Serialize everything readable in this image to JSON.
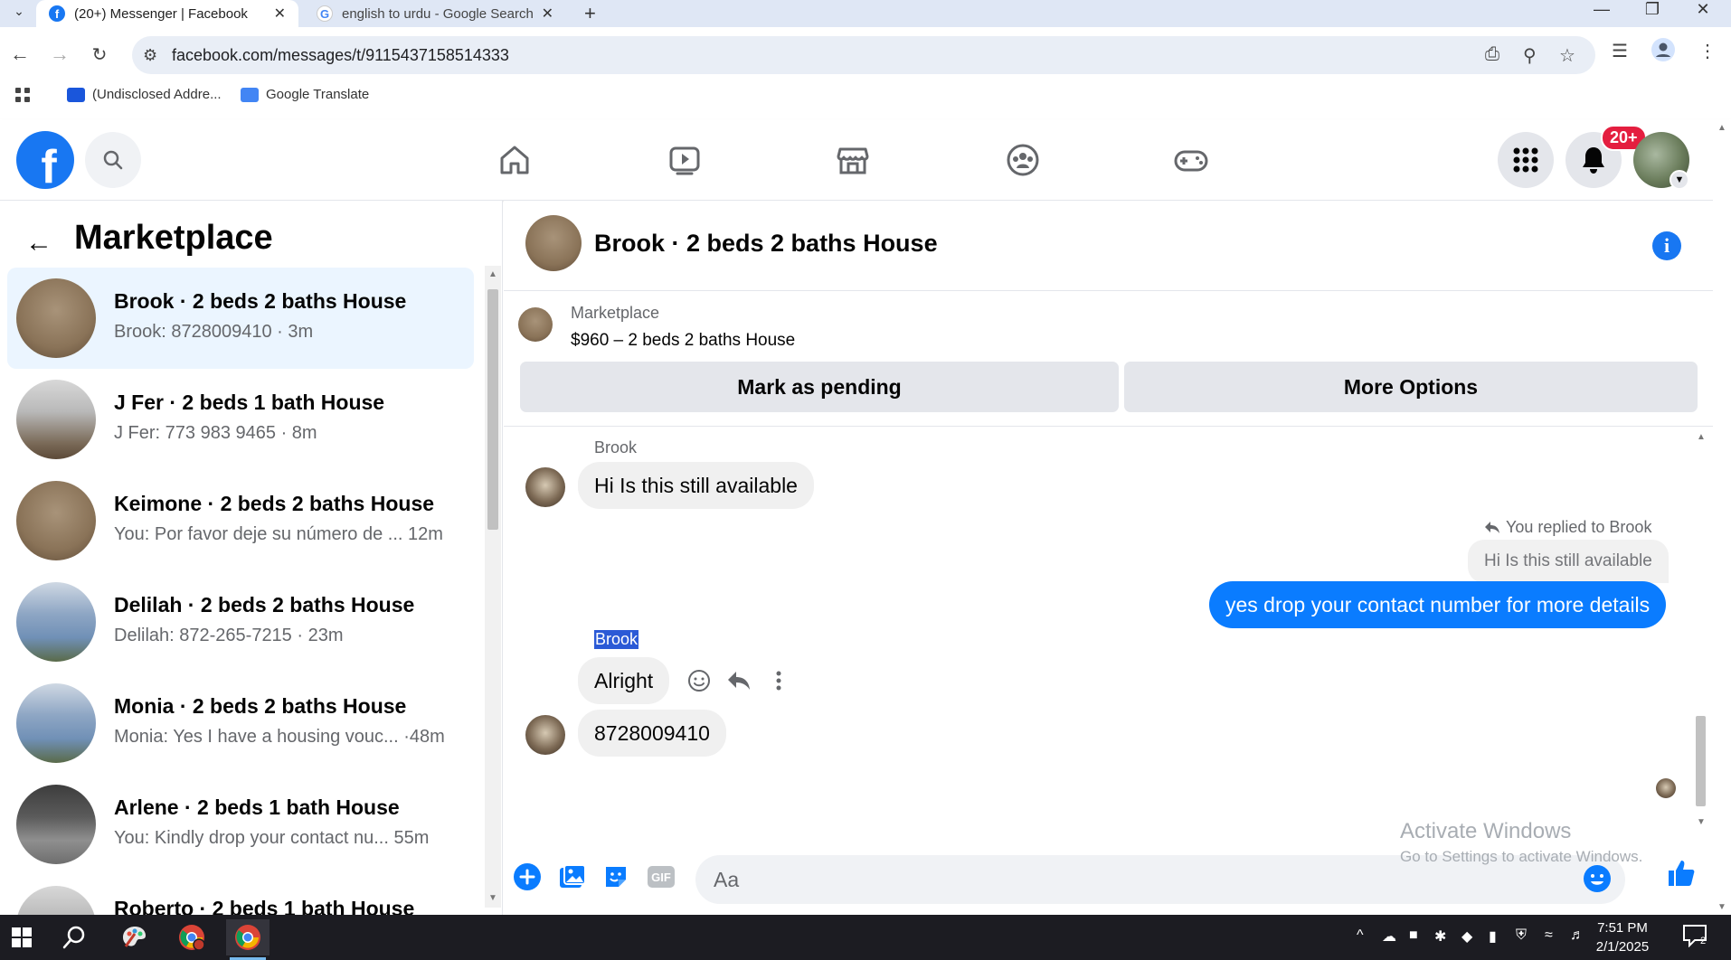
{
  "browser": {
    "tabs": [
      {
        "title": "(20+) Messenger | Facebook",
        "active": true
      },
      {
        "title": "english to urdu - Google Search",
        "active": false
      }
    ],
    "url": "facebook.com/messages/t/9115437158514333",
    "bookmarks": [
      {
        "label": "(Undisclosed Addre..."
      },
      {
        "label": "Google Translate"
      }
    ]
  },
  "header": {
    "notification_count": "20+",
    "accent_color": "#1877f2"
  },
  "sidebar": {
    "title": "Marketplace",
    "conversations": [
      {
        "name": "Brook · 2 beds 2 baths House",
        "preview": "Brook: 8728009410 · 3m",
        "selected": true
      },
      {
        "name": "J Fer · 2 beds 1 bath House",
        "preview": "J Fer: 773 983 9465 · 8m"
      },
      {
        "name": "Keimone · 2 beds 2 baths House",
        "preview": "You: Por favor deje su número de ...  12m"
      },
      {
        "name": "Delilah · 2 beds 2 baths House",
        "preview": "Delilah: 872-265-7215 · 23m"
      },
      {
        "name": "Monia · 2 beds 2 baths House",
        "preview": "Monia: Yes I have a housing vouc... ·48m"
      },
      {
        "name": "Arlene · 2 beds 1 bath House",
        "preview": "You: Kindly drop your contact nu...  55m"
      },
      {
        "name": "Roberto · 2 beds 1 bath House",
        "preview": ""
      }
    ]
  },
  "chat": {
    "title": "Brook · 2 beds 2 baths House",
    "listing": {
      "source": "Marketplace",
      "price_title": "$960 – 2 beds 2 baths House",
      "mark_pending_label": "Mark as pending",
      "more_options_label": "More Options"
    },
    "messages": {
      "sender1": "Brook",
      "msg1": "Hi Is this still available",
      "reply_label": "You replied to Brook",
      "quoted": "Hi Is this still available",
      "msg2": "yes drop your contact number for more details",
      "sender2": "Brook",
      "msg3": "Alright",
      "msg4": "8728009410"
    },
    "composer_placeholder": "Aa"
  },
  "watermark": {
    "line1": "Activate Windows",
    "line2": "Go to Settings to activate Windows."
  },
  "taskbar": {
    "time": "7:51 PM",
    "date": "2/1/2025"
  }
}
